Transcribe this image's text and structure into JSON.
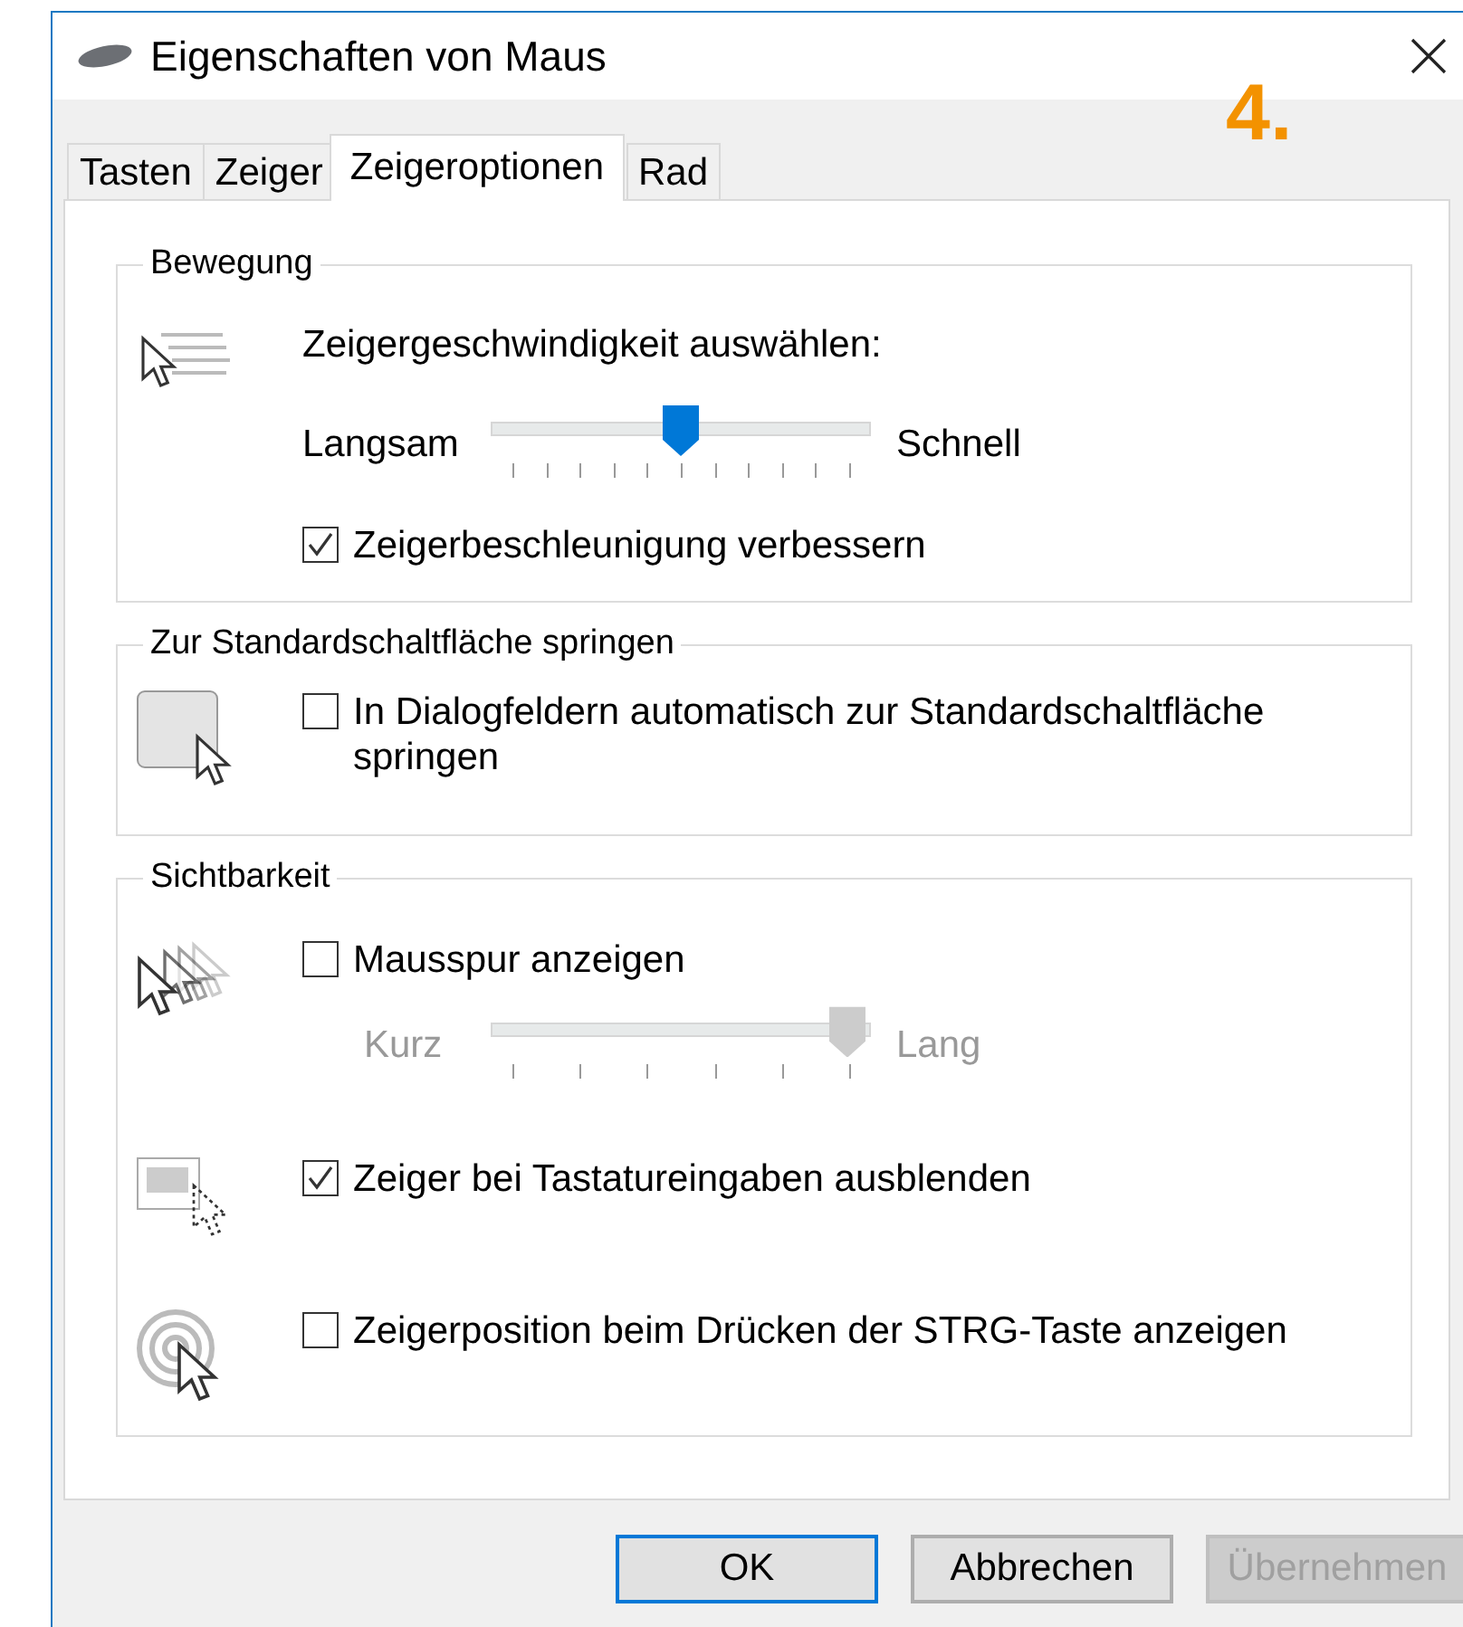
{
  "window": {
    "title": "Eigenschaften von Maus",
    "annotation": "4."
  },
  "tabs": [
    {
      "label": "Tasten",
      "selected": false
    },
    {
      "label": "Zeiger",
      "selected": false
    },
    {
      "label": "Zeigeroptionen",
      "selected": true
    },
    {
      "label": "Rad",
      "selected": false
    }
  ],
  "groups": [
    {
      "title": "Bewegung",
      "sections": [
        {
          "controls": [
            {
              "kind": "label",
              "text": "Zeigergeschwindigkeit auswählen:"
            },
            {
              "kind": "slider",
              "min_label": "Langsam",
              "max_label": "Schnell",
              "level": 0.5,
              "disabled": false
            },
            {
              "kind": "checkbox",
              "label": "Zeigerbeschleunigung verbessern",
              "checked": true
            }
          ]
        }
      ]
    },
    {
      "title": "Zur Standardschaltfläche springen",
      "sections": [
        {
          "controls": [
            {
              "kind": "checkbox",
              "label": "In Dialogfeldern automatisch zur Standardschaltfläche springen",
              "checked": false
            }
          ]
        }
      ]
    },
    {
      "title": "Sichtbarkeit",
      "sections": [
        {
          "controls": [
            {
              "kind": "checkbox",
              "label": "Mausspur anzeigen",
              "checked": false
            },
            {
              "kind": "slider",
              "min_label": "Kurz",
              "max_label": "Lang",
              "level": 1,
              "disabled": true
            }
          ]
        },
        {
          "controls": [
            {
              "kind": "checkbox",
              "label": "Zeiger bei Tastatureingaben ausblenden",
              "checked": true
            }
          ]
        },
        {
          "controls": [
            {
              "kind": "checkbox",
              "label": "Zeigerposition beim Drücken der STRG-Taste anzeigen",
              "checked": false
            }
          ]
        }
      ]
    }
  ],
  "buttons": [
    {
      "label": "OK",
      "default": true,
      "disabled": false
    },
    {
      "label": "Abbrechen",
      "default": false,
      "disabled": false
    },
    {
      "label": "Übernehmen",
      "default": false,
      "disabled": true
    }
  ]
}
